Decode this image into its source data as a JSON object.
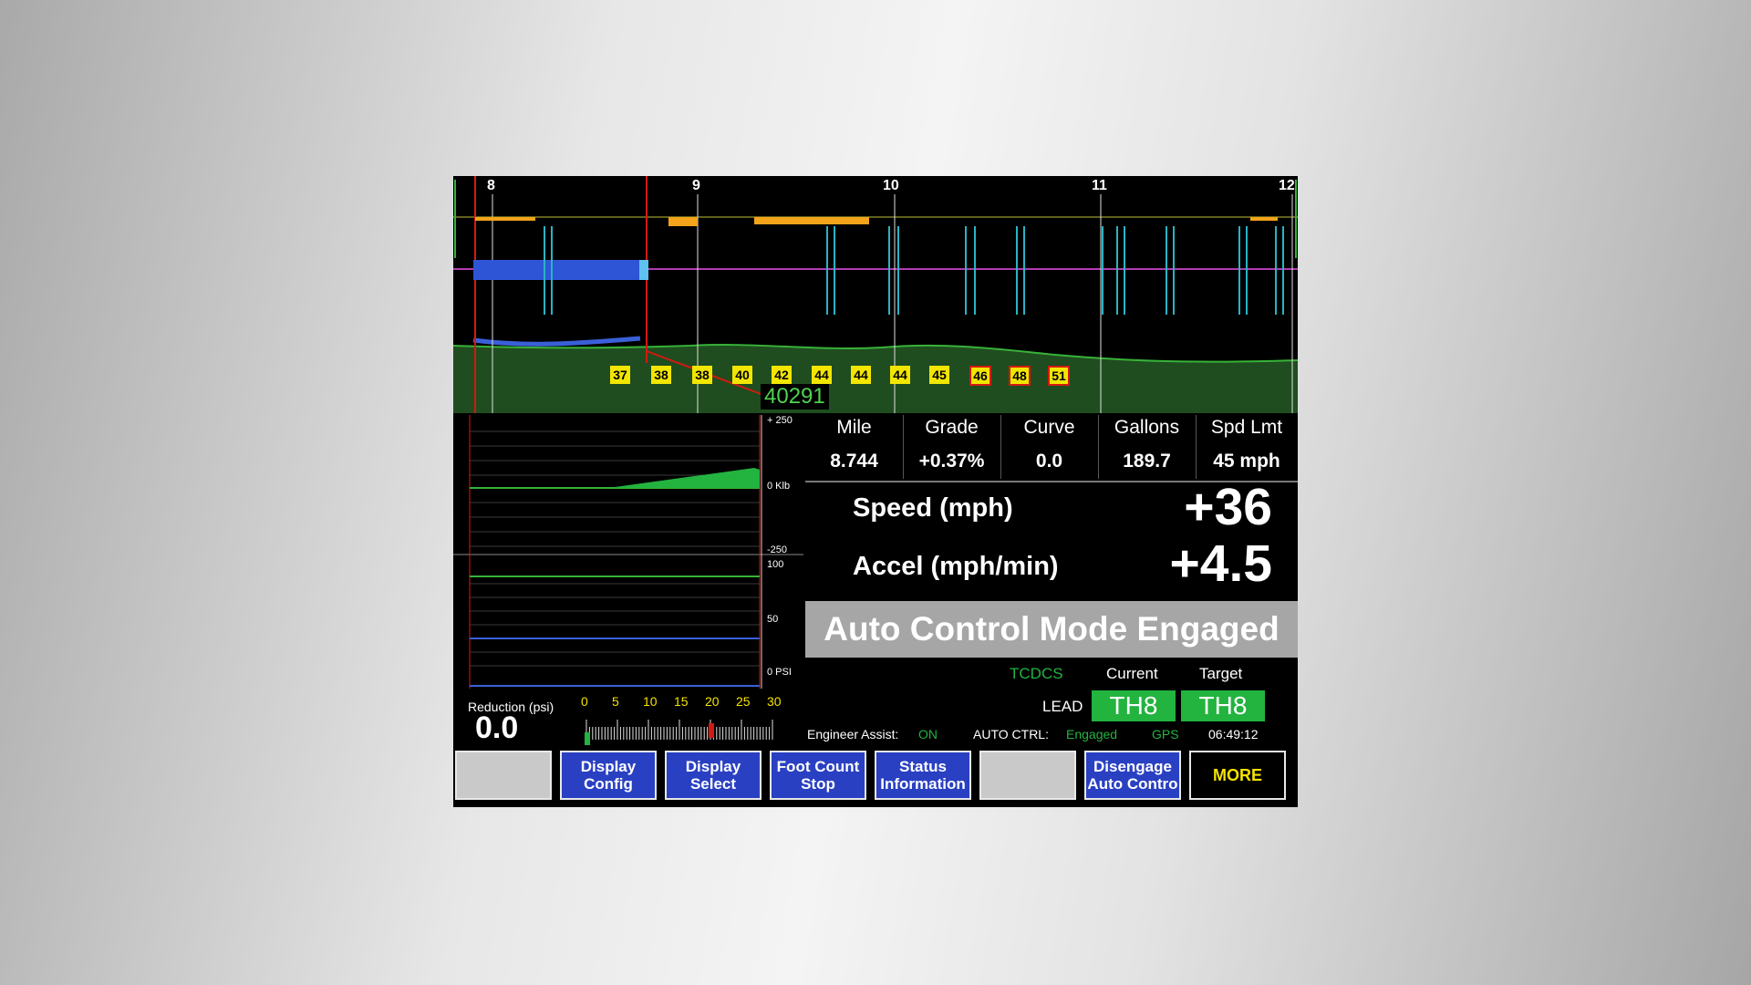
{
  "track": {
    "mile_markers": [
      "8",
      "9",
      "10",
      "11",
      "12"
    ],
    "speed_limits": [
      {
        "value": "37",
        "flag": false
      },
      {
        "value": "38",
        "flag": false
      },
      {
        "value": "38",
        "flag": false
      },
      {
        "value": "40",
        "flag": false
      },
      {
        "value": "42",
        "flag": false
      },
      {
        "value": "44",
        "flag": false
      },
      {
        "value": "44",
        "flag": false
      },
      {
        "value": "44",
        "flag": false
      },
      {
        "value": "45",
        "flag": false
      },
      {
        "value": "46",
        "flag": true
      },
      {
        "value": "48",
        "flag": true
      },
      {
        "value": "51",
        "flag": true
      }
    ],
    "foot_count": "40291"
  },
  "graphs": {
    "force_top": "+ 250",
    "force_mid": "0 Klb",
    "force_bottom": "-250",
    "brake_top": "100",
    "brake_mid": "50",
    "brake_bottom": "0 PSI"
  },
  "reduction": {
    "label": "Reduction (psi)",
    "value": "0.0",
    "scale": [
      "0",
      "5",
      "10",
      "15",
      "20",
      "25",
      "30"
    ]
  },
  "data_table": [
    {
      "header": "Mile",
      "value": "8.744"
    },
    {
      "header": "Grade",
      "value": "+0.37%"
    },
    {
      "header": "Curve",
      "value": "0.0"
    },
    {
      "header": "Gallons",
      "value": "189.7"
    },
    {
      "header": "Spd Lmt",
      "value": "45 mph"
    }
  ],
  "speed": {
    "label": "Speed  (mph)",
    "value": "+36"
  },
  "accel": {
    "label": "Accel  (mph/min)",
    "value": "+4.5"
  },
  "mode_banner": "Auto Control Mode Engaged",
  "tcdcs": {
    "title": "TCDCS",
    "current_label": "Current",
    "target_label": "Target",
    "lead_label": "LEAD",
    "current_value": "TH8",
    "target_value": "TH8"
  },
  "status_line": {
    "engineer_assist_label": "Engineer Assist:",
    "engineer_assist_value": "ON",
    "auto_ctrl_label": "AUTO CTRL:",
    "auto_ctrl_value": "Engaged",
    "gps": "GPS",
    "time": "06:49:12"
  },
  "buttons": [
    {
      "label": "",
      "style": "gray"
    },
    {
      "label": "Display\nConfig",
      "style": "blue"
    },
    {
      "label": "Display\nSelect",
      "style": "blue"
    },
    {
      "label": "Foot Count\nStop",
      "style": "blue"
    },
    {
      "label": "Status\nInformation",
      "style": "blue"
    },
    {
      "label": "",
      "style": "gray"
    },
    {
      "label": "Disengage\nAuto Contro",
      "style": "blue"
    },
    {
      "label": "MORE",
      "style": "more"
    }
  ],
  "colors": {
    "speed_box": "#f2e600",
    "green": "#23b33f",
    "button_blue": "#2a40c2",
    "banner_gray": "#a6a6a6"
  }
}
